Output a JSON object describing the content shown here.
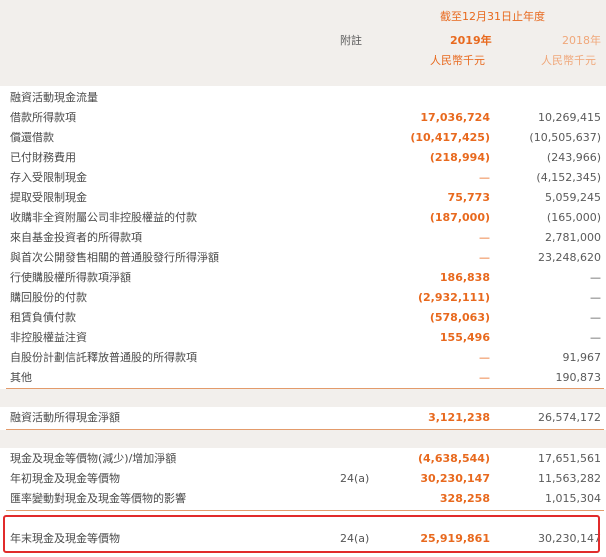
{
  "header": {
    "period": "截至12月31日止年度",
    "note_col": "附註",
    "year_2019": "2019年",
    "year_2018": "2018年",
    "unit_2019": "人民幣千元",
    "unit_2018": "人民幣千元"
  },
  "section_title": "融資活動現金流量",
  "financing_rows": [
    {
      "label": "借款所得款項",
      "note": "",
      "v2019": "17,036,724",
      "v2018": "10,269,415"
    },
    {
      "label": "償還借款",
      "note": "",
      "v2019": "(10,417,425)",
      "v2018": "(10,505,637)"
    },
    {
      "label": "已付財務費用",
      "note": "",
      "v2019": "(218,994)",
      "v2018": "(243,966)"
    },
    {
      "label": "存入受限制現金",
      "note": "",
      "v2019": "—",
      "v2018": "(4,152,345)"
    },
    {
      "label": "提取受限制現金",
      "note": "",
      "v2019": "75,773",
      "v2018": "5,059,245"
    },
    {
      "label": "收購非全資附屬公司非控股權益的付款",
      "note": "",
      "v2019": "(187,000)",
      "v2018": "(165,000)"
    },
    {
      "label": "來自基金投資者的所得款項",
      "note": "",
      "v2019": "—",
      "v2018": "2,781,000"
    },
    {
      "label": "與首次公開發售相關的普通股發行所得淨額",
      "note": "",
      "v2019": "—",
      "v2018": "23,248,620"
    },
    {
      "label": "行使購股權所得款項淨額",
      "note": "",
      "v2019": "186,838",
      "v2018": "—"
    },
    {
      "label": "購回股份的付款",
      "note": "",
      "v2019": "(2,932,111)",
      "v2018": "—"
    },
    {
      "label": "租賃負債付款",
      "note": "",
      "v2019": "(578,063)",
      "v2018": "—"
    },
    {
      "label": "非控股權益注資",
      "note": "",
      "v2019": "155,496",
      "v2018": "—"
    },
    {
      "label": "自股份計劃信託釋放普通股的所得款項",
      "note": "",
      "v2019": "—",
      "v2018": "91,967"
    },
    {
      "label": "其他",
      "note": "",
      "v2019": "—",
      "v2018": "190,873"
    }
  ],
  "net_financing": {
    "label": "融資活動所得現金淨額",
    "note": "",
    "v2019": "3,121,238",
    "v2018": "26,574,172"
  },
  "summary_rows": [
    {
      "label": "現金及現金等價物(減少)/增加淨額",
      "note": "",
      "v2019": "(4,638,544)",
      "v2018": "17,651,561"
    },
    {
      "label": "年初現金及現金等價物",
      "note": "24(a)",
      "v2019": "30,230,147",
      "v2018": "11,563,282"
    },
    {
      "label": "匯率變動對現金及現金等價物的影響",
      "note": "",
      "v2019": "328,258",
      "v2018": "1,015,304"
    }
  ],
  "year_end": {
    "label": "年末現金及現金等價物",
    "note": "24(a)",
    "v2019": "25,919,861",
    "v2018": "30,230,147"
  }
}
